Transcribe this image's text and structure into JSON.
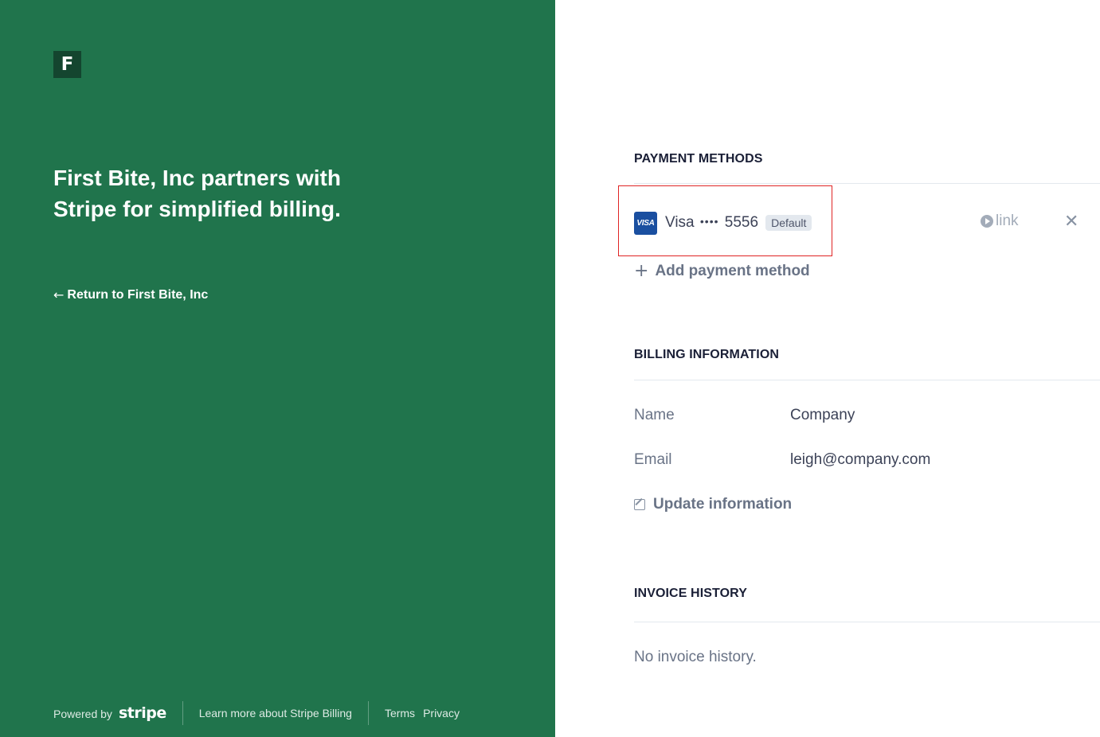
{
  "brand": {
    "color": "#20744c",
    "logo_letter": "F",
    "headline": "First Bite, Inc partners with Stripe for simplified billing.",
    "return_link": "Return to First Bite, Inc"
  },
  "footer": {
    "powered_by": "Powered by",
    "stripe_word": "stripe",
    "learn_more": "Learn more about Stripe Billing",
    "terms": "Terms",
    "privacy": "Privacy"
  },
  "payment_methods": {
    "title": "PAYMENT METHODS",
    "card": {
      "brand_icon_text": "VISA",
      "brand": "Visa",
      "mask": "••••",
      "last4": "5556",
      "badge": "Default",
      "link_label": "link"
    },
    "add_label": "Add payment method"
  },
  "billing_information": {
    "title": "BILLING INFORMATION",
    "rows": [
      {
        "label": "Name",
        "value": "Company"
      },
      {
        "label": "Email",
        "value": "leigh@company.com"
      }
    ],
    "update_label": "Update information"
  },
  "invoice_history": {
    "title": "INVOICE HISTORY",
    "empty_text": "No invoice history."
  },
  "colors": {
    "highlight": "#e02424",
    "visa_blue": "#1a4fa0"
  }
}
